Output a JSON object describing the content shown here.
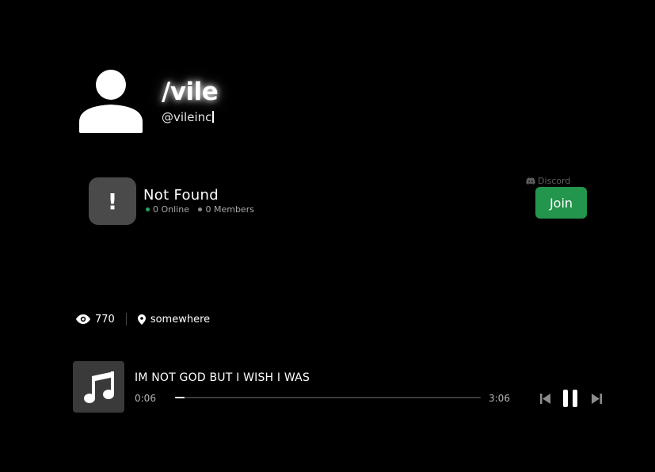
{
  "profile": {
    "username": "/vile",
    "handle": "@vileinc",
    "avatar_icon": "user-icon"
  },
  "discord": {
    "server_icon_glyph": "!",
    "server_name": "Not Found",
    "online_text": "0 Online",
    "members_text": "0 Members",
    "platform_label": "Discord",
    "join_label": "Join",
    "colors": {
      "online": "#23a55a",
      "join": "#23954d"
    }
  },
  "stats": {
    "views": "770",
    "location": "somewhere",
    "views_icon": "eye-icon",
    "location_icon": "map-pin-icon"
  },
  "player": {
    "title": "IM NOT GOD BUT I WISH I WAS",
    "current_time": "0:06",
    "total_time": "3:06",
    "progress": 0.032,
    "cover_icon": "music-note-icon",
    "controls": [
      "skip-back-icon",
      "pause-icon",
      "skip-forward-icon"
    ]
  }
}
